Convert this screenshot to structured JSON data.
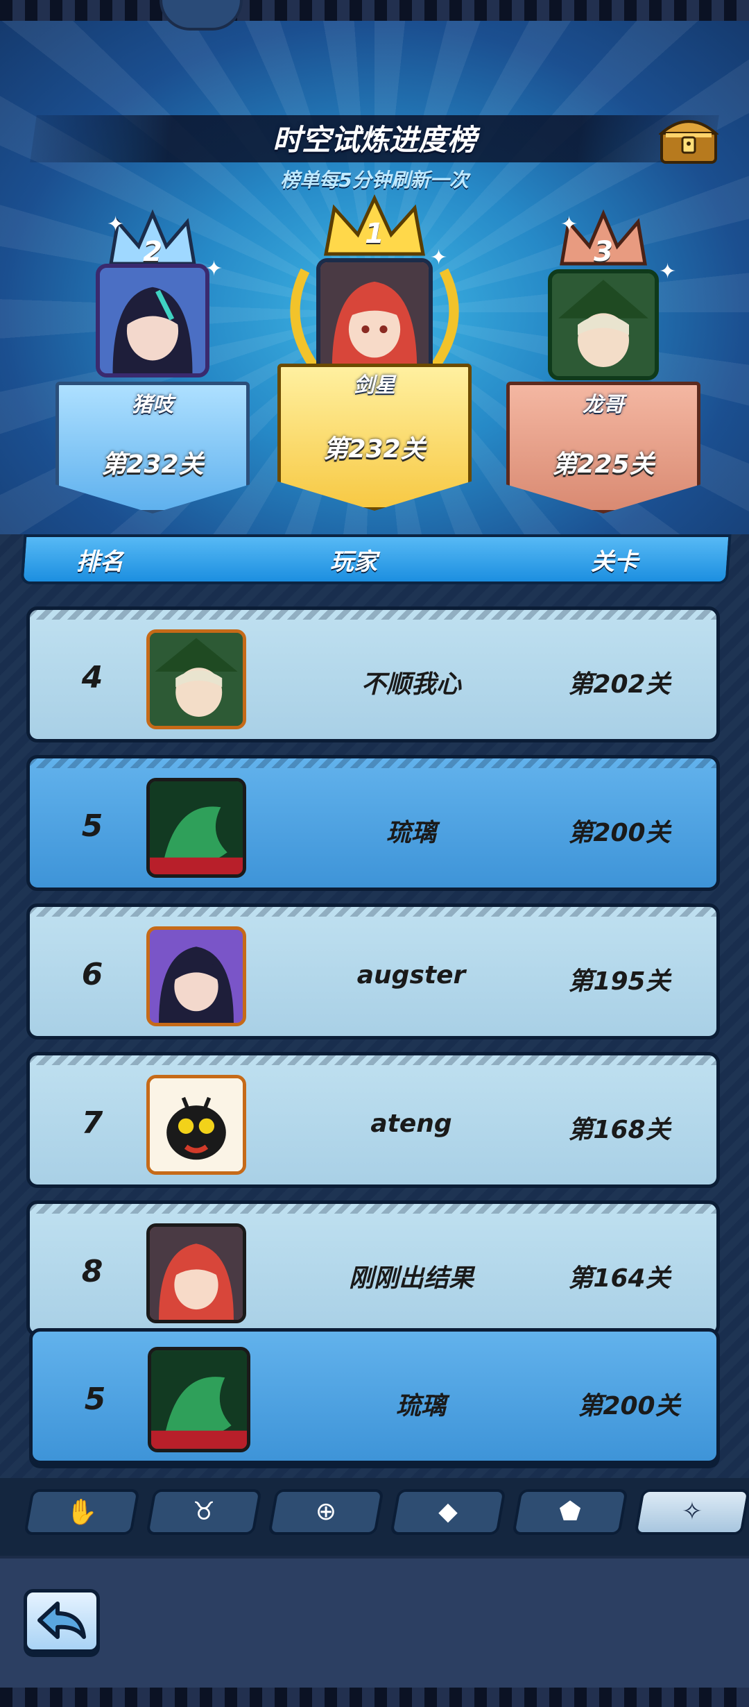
{
  "header": {
    "title": "时空试炼进度榜",
    "subtitle": "榜单每5分钟刷新一次"
  },
  "podium": [
    {
      "rank": "1",
      "name": "剑星",
      "stage": "第232关"
    },
    {
      "rank": "2",
      "name": "猪吱",
      "stage": "第232关"
    },
    {
      "rank": "3",
      "name": "龙哥",
      "stage": "第225关"
    }
  ],
  "table": {
    "columns": [
      "排名",
      "玩家",
      "关卡"
    ],
    "rows": [
      {
        "rank": "4",
        "player": "不顺我心",
        "stage": "第202关",
        "avatar": "green-hood-elf-avatar"
      },
      {
        "rank": "5",
        "player": "琉璃",
        "stage": "第200关",
        "avatar": "green-dragon-avatar"
      },
      {
        "rank": "6",
        "player": "augster",
        "stage": "第195关",
        "avatar": "purple-hair-girl-avatar"
      },
      {
        "rank": "7",
        "player": "ateng",
        "stage": "第168关",
        "avatar": "black-bug-avatar"
      },
      {
        "rank": "8",
        "player": "刚刚出结果",
        "stage": "第164关",
        "avatar": "red-hair-girl-avatar"
      }
    ]
  },
  "my_rank": {
    "rank": "5",
    "player": "琉璃",
    "stage": "第200关"
  },
  "tabs": [
    {
      "icon": "hand-icon",
      "glyph": "✋"
    },
    {
      "icon": "horns-icon",
      "glyph": "♉"
    },
    {
      "icon": "shield-icon",
      "glyph": "⊕"
    },
    {
      "icon": "crystal-icon",
      "glyph": "◆"
    },
    {
      "icon": "gem-icon",
      "glyph": "⬟"
    },
    {
      "icon": "sparkle-icon",
      "glyph": "✧"
    }
  ],
  "colors": {
    "row_light": "#bfe0f0",
    "row_dark": "#4aa0e0",
    "gold": "#f7c944",
    "silver_blue": "#7cc5f2",
    "bronze": "#d98a72"
  }
}
